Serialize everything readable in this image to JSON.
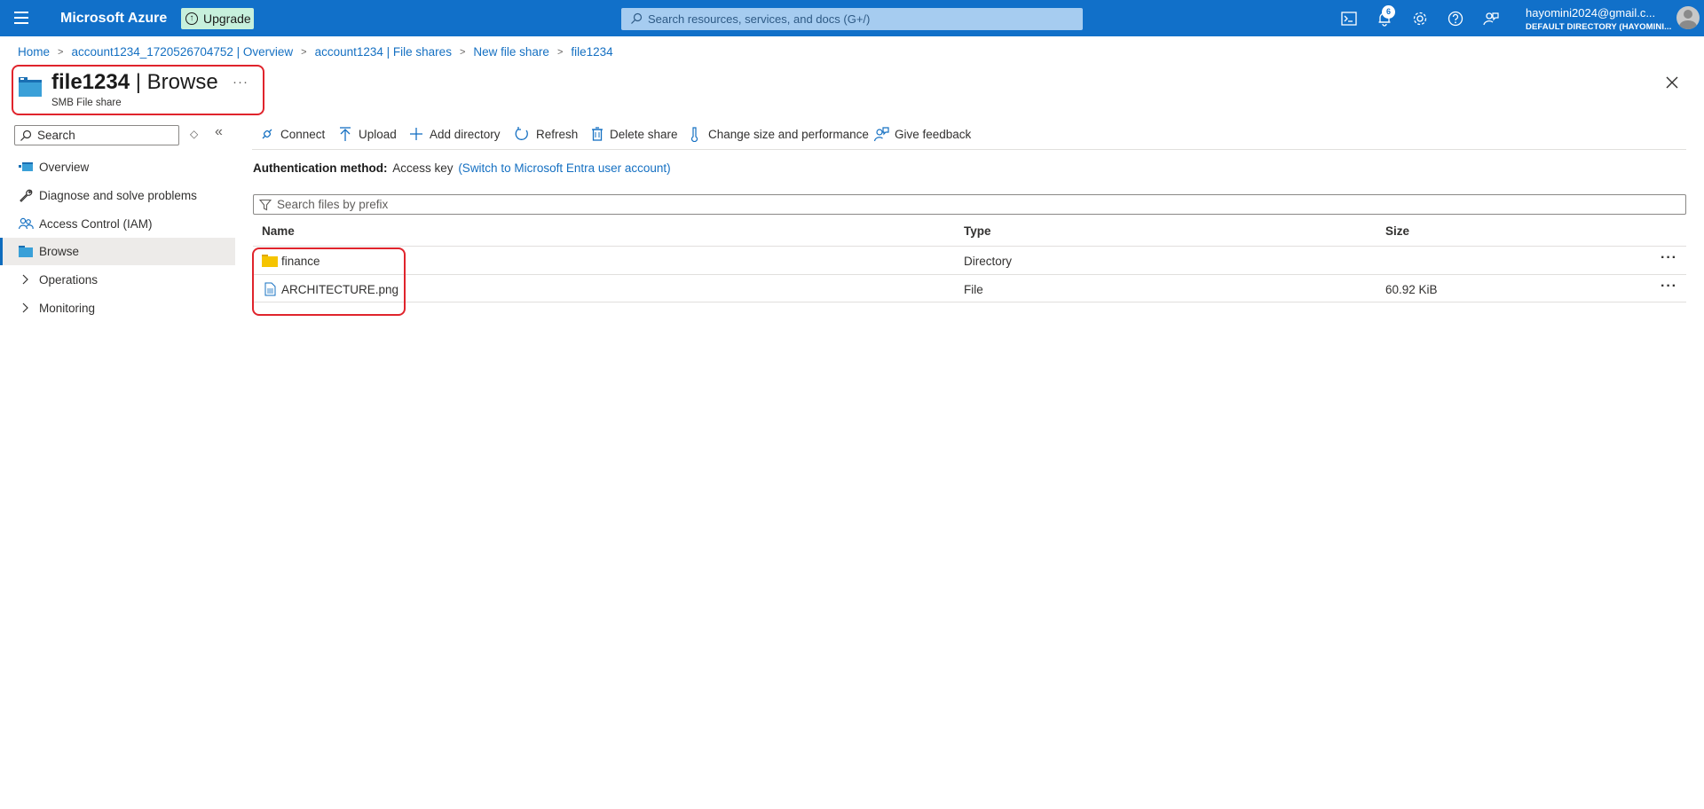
{
  "topbar": {
    "brand": "Microsoft Azure",
    "upgrade_label": "Upgrade",
    "search_placeholder": "Search resources, services, and docs (G+/)",
    "notification_count": "6",
    "user_email": "hayomini2024@gmail.c...",
    "user_directory": "DEFAULT DIRECTORY (HAYOMINI..."
  },
  "breadcrumb": [
    "Home",
    "account1234_1720526704752 | Overview",
    "account1234 | File shares",
    "New file share",
    "file1234"
  ],
  "header": {
    "title_name": "file1234",
    "title_sep": " | ",
    "title_section": "Browse",
    "subtitle": "SMB File share",
    "more": "···"
  },
  "nav": {
    "search_placeholder": "Search",
    "items": [
      {
        "label": "Overview",
        "icon": "overview-icon"
      },
      {
        "label": "Diagnose and solve problems",
        "icon": "wrench-icon"
      },
      {
        "label": "Access Control (IAM)",
        "icon": "people-icon"
      },
      {
        "label": "Browse",
        "icon": "folder-icon",
        "active": true
      },
      {
        "label": "Operations",
        "icon": "chevron-right-icon"
      },
      {
        "label": "Monitoring",
        "icon": "chevron-right-icon"
      }
    ]
  },
  "toolbar": {
    "connect": "Connect",
    "upload": "Upload",
    "add_directory": "Add directory",
    "refresh": "Refresh",
    "delete_share": "Delete share",
    "change_size": "Change size and performance",
    "give_feedback": "Give feedback"
  },
  "auth": {
    "label": "Authentication method:",
    "value": "Access key",
    "link": "(Switch to Microsoft Entra user account)"
  },
  "filter": {
    "placeholder": "Search files by prefix"
  },
  "table": {
    "columns": [
      "Name",
      "Type",
      "Size"
    ],
    "rows": [
      {
        "name": "finance",
        "type": "Directory",
        "size": "",
        "icon": "folder-icon"
      },
      {
        "name": "ARCHITECTURE.png",
        "type": "File",
        "size": "60.92 KiB",
        "icon": "file-icon"
      }
    ]
  },
  "colors": {
    "topbar": "#1170c9",
    "link": "#1570c2",
    "highlight_box": "#e0242c",
    "folder": "#f0c000"
  }
}
